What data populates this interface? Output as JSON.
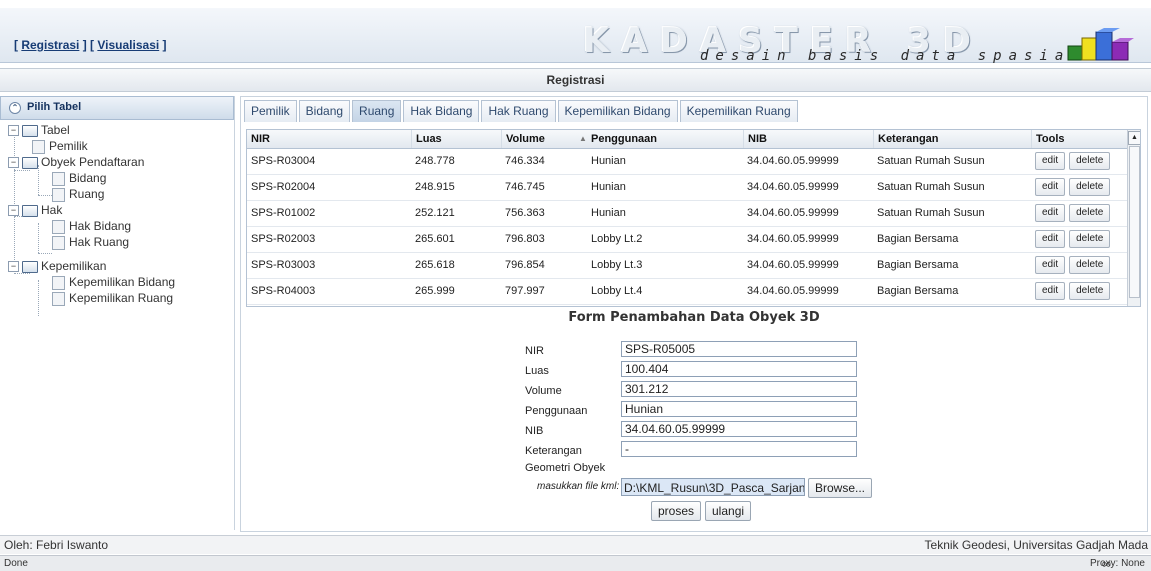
{
  "header": {
    "link_registrasi": "Registrasi",
    "link_visualisasi": "Visualisasi",
    "logo_title": "KADASTER 3D",
    "logo_subtitle": "desain basis data spasial"
  },
  "page_title": "Registrasi",
  "left_panel": {
    "title": "Pilih Tabel",
    "tree": {
      "root": "Tabel",
      "pemilik": "Pemilik",
      "obyek": "Obyek Pendaftaran",
      "bidang": "Bidang",
      "ruang": "Ruang",
      "hak": "Hak",
      "hak_bidang": "Hak Bidang",
      "hak_ruang": "Hak Ruang",
      "kepemilikan": "Kepemilikan",
      "kepemilikan_bidang": "Kepemilikan Bidang",
      "kepemilikan_ruang": "Kepemilikan Ruang"
    }
  },
  "tabs": [
    "Pemilik",
    "Bidang",
    "Ruang",
    "Hak Bidang",
    "Hak Ruang",
    "Kepemilikan Bidang",
    "Kepemilikan Ruang"
  ],
  "active_tab": "Ruang",
  "table": {
    "columns": [
      "NIR",
      "Luas",
      "Volume",
      "Penggunaan",
      "NIB",
      "Keterangan",
      "Tools"
    ],
    "sort_indicator": "▲",
    "edit_label": "edit",
    "delete_label": "delete",
    "rows": [
      [
        "SPS-R03004",
        "248.778",
        "746.334",
        "Hunian",
        "34.04.60.05.99999",
        "Satuan Rumah Susun"
      ],
      [
        "SPS-R02004",
        "248.915",
        "746.745",
        "Hunian",
        "34.04.60.05.99999",
        "Satuan Rumah Susun"
      ],
      [
        "SPS-R01002",
        "252.121",
        "756.363",
        "Hunian",
        "34.04.60.05.99999",
        "Satuan Rumah Susun"
      ],
      [
        "SPS-R02003",
        "265.601",
        "796.803",
        "Lobby Lt.2",
        "34.04.60.05.99999",
        "Bagian Bersama"
      ],
      [
        "SPS-R03003",
        "265.618",
        "796.854",
        "Lobby Lt.3",
        "34.04.60.05.99999",
        "Bagian Bersama"
      ],
      [
        "SPS-R04003",
        "265.999",
        "797.997",
        "Lobby Lt.4",
        "34.04.60.05.99999",
        "Bagian Bersama"
      ]
    ]
  },
  "form": {
    "title": "Form Penambahan Data Obyek 3D",
    "nir_label": "NIR",
    "nir_value": "SPS-R05005",
    "luas_label": "Luas",
    "luas_value": "100.404",
    "volume_label": "Volume",
    "volume_value": "301.212",
    "penggunaan_label": "Penggunaan",
    "penggunaan_value": "Hunian",
    "nib_label": "NIB",
    "nib_value": "34.04.60.05.99999",
    "keterangan_label": "Keterangan",
    "keterangan_value": "-",
    "geometri_label": "Geometri Obyek",
    "kml_label": "masukkan file kml:",
    "kml_value": "D:\\KML_Rusun\\3D_Pasca_Sarjan",
    "browse_label": "Browse...",
    "proses_label": "proses",
    "ulangi_label": "ulangi"
  },
  "footer": {
    "author": "Oleh: Febri Iswanto",
    "institution": "Teknik Geodesi, Universitas Gadjah Mada"
  },
  "statusbar": {
    "status": "Done",
    "proxy": "Proxy: None"
  }
}
